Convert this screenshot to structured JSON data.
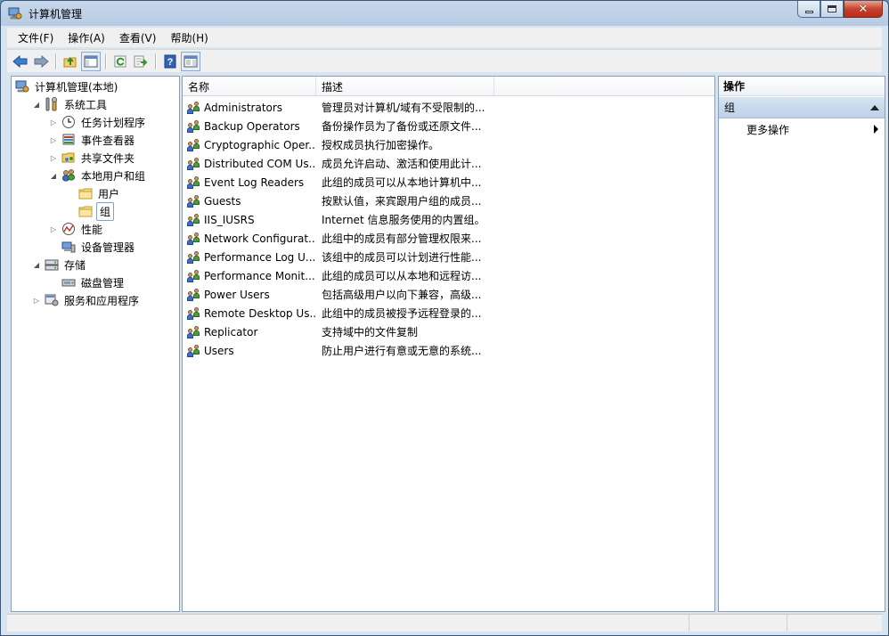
{
  "window": {
    "title": "计算机管理"
  },
  "menu": [
    "文件(F)",
    "操作(A)",
    "查看(V)",
    "帮助(H)"
  ],
  "toolbar": [
    "back-icon",
    "forward-icon",
    "up-folder-icon",
    "show-hide-tree-icon",
    "refresh-icon",
    "export-list-icon",
    "help-icon",
    "properties-icon"
  ],
  "tree": [
    {
      "label": "计算机管理(本地)",
      "level": 0,
      "state": "none",
      "icon": "computer-management-icon"
    },
    {
      "label": "系统工具",
      "level": 1,
      "state": "expanded",
      "icon": "system-tools-icon"
    },
    {
      "label": "任务计划程序",
      "level": 2,
      "state": "collapsed",
      "icon": "clock-icon"
    },
    {
      "label": "事件查看器",
      "level": 2,
      "state": "collapsed",
      "icon": "event-viewer-icon"
    },
    {
      "label": "共享文件夹",
      "level": 2,
      "state": "collapsed",
      "icon": "shared-folder-icon"
    },
    {
      "label": "本地用户和组",
      "level": 2,
      "state": "expanded",
      "icon": "users-icon"
    },
    {
      "label": "用户",
      "level": 3,
      "state": "none",
      "icon": "folder-icon"
    },
    {
      "label": "组",
      "level": 3,
      "state": "none",
      "icon": "folder-icon",
      "selected": true
    },
    {
      "label": "性能",
      "level": 2,
      "state": "collapsed",
      "icon": "performance-icon"
    },
    {
      "label": "设备管理器",
      "level": 2,
      "state": "none",
      "icon": "device-manager-icon"
    },
    {
      "label": "存储",
      "level": 1,
      "state": "expanded",
      "icon": "storage-icon"
    },
    {
      "label": "磁盘管理",
      "level": 2,
      "state": "none",
      "icon": "disk-icon"
    },
    {
      "label": "服务和应用程序",
      "level": 1,
      "state": "collapsed",
      "icon": "services-icon"
    }
  ],
  "list": {
    "columns": [
      "名称",
      "描述"
    ],
    "rows": [
      {
        "name": "Administrators",
        "desc": "管理员对计算机/域有不受限制的..."
      },
      {
        "name": "Backup Operators",
        "desc": "备份操作员为了备份或还原文件..."
      },
      {
        "name": "Cryptographic Oper...",
        "desc": "授权成员执行加密操作。"
      },
      {
        "name": "Distributed COM Us...",
        "desc": "成员允许启动、激活和使用此计..."
      },
      {
        "name": "Event Log Readers",
        "desc": "此组的成员可以从本地计算机中..."
      },
      {
        "name": "Guests",
        "desc": "按默认值，来宾跟用户组的成员..."
      },
      {
        "name": "IIS_IUSRS",
        "desc": "Internet 信息服务使用的内置组。"
      },
      {
        "name": "Network Configurat...",
        "desc": "此组中的成员有部分管理权限来..."
      },
      {
        "name": "Performance Log U...",
        "desc": "该组中的成员可以计划进行性能..."
      },
      {
        "name": "Performance Monit...",
        "desc": "此组的成员可以从本地和远程访..."
      },
      {
        "name": "Power Users",
        "desc": "包括高级用户以向下兼容，高级..."
      },
      {
        "name": "Remote Desktop Us...",
        "desc": "此组中的成员被授予远程登录的..."
      },
      {
        "name": "Replicator",
        "desc": "支持域中的文件复制"
      },
      {
        "name": "Users",
        "desc": "防止用户进行有意或无意的系统..."
      }
    ]
  },
  "actions": {
    "header": "操作",
    "group": "组",
    "more": "更多操作"
  }
}
